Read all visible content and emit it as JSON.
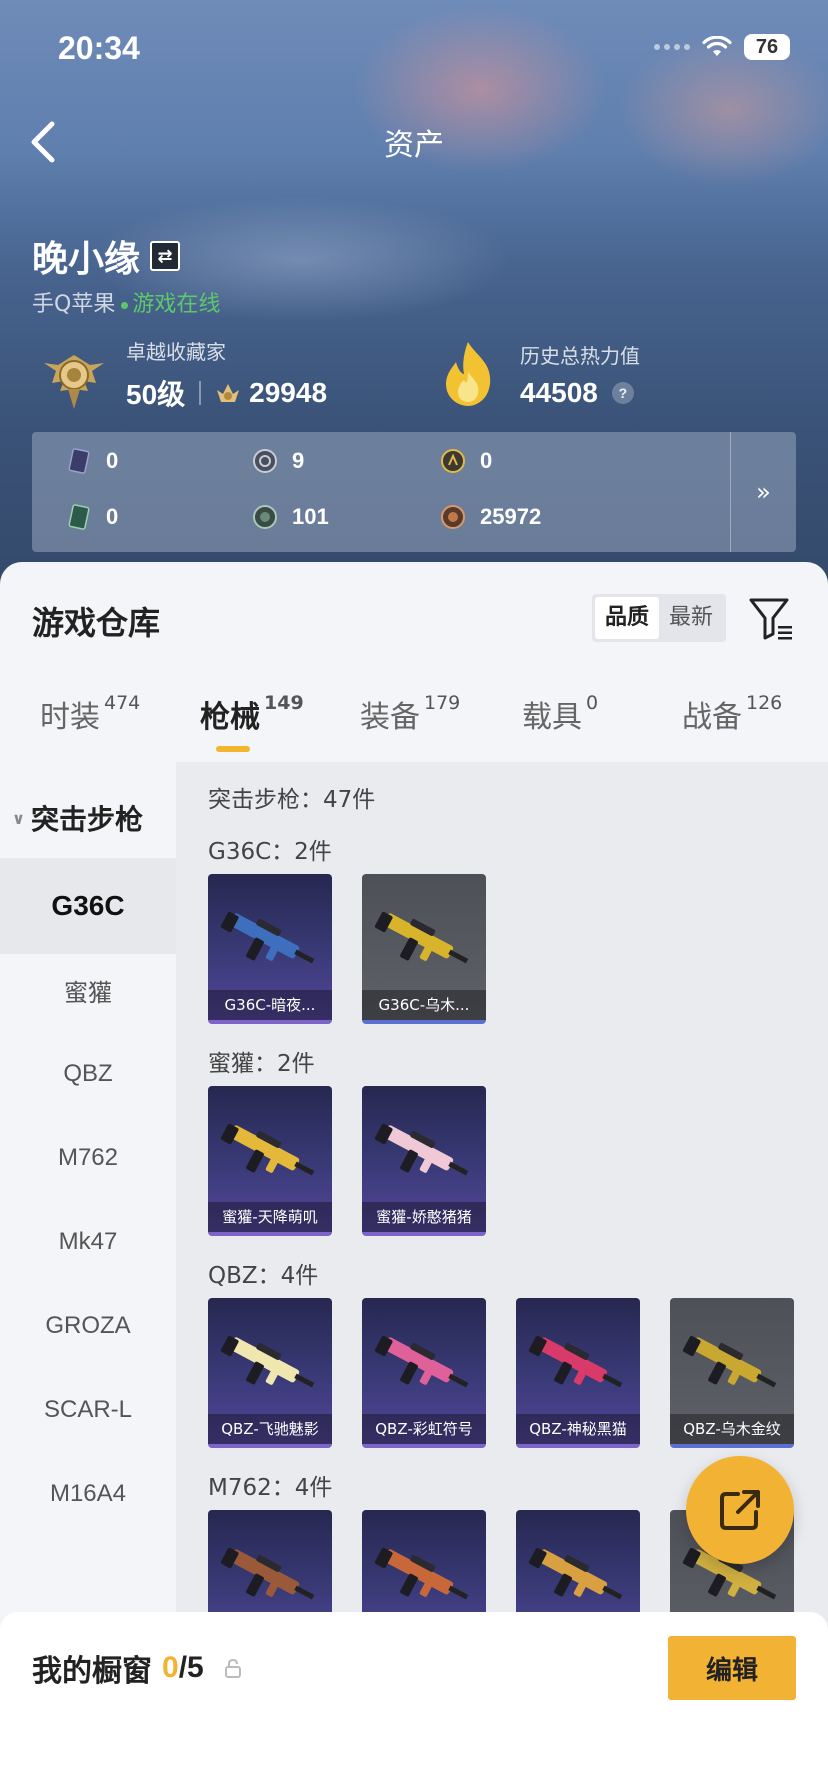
{
  "status_bar": {
    "time": "20:34",
    "battery": "76"
  },
  "nav": {
    "title": "资产"
  },
  "user": {
    "name": "晚小缘",
    "platform": "手Q苹果",
    "online_status": "游戏在线"
  },
  "collector": {
    "title": "卓越收藏家",
    "level": "50级",
    "points": "29948"
  },
  "heat": {
    "title": "历史总热力值",
    "value": "44508",
    "help": "?"
  },
  "currencies": {
    "row1": [
      "0",
      "9",
      "0"
    ],
    "row2": [
      "0",
      "101",
      "25972"
    ],
    "more": "»"
  },
  "warehouse": {
    "title": "游戏仓库",
    "sort": [
      "品质",
      "最新"
    ],
    "tabs": [
      {
        "label": "时装",
        "count": "474"
      },
      {
        "label": "枪械",
        "count": "149"
      },
      {
        "label": "装备",
        "count": "179"
      },
      {
        "label": "载具",
        "count": "0"
      },
      {
        "label": "战备",
        "count": "126"
      }
    ]
  },
  "sidebar": {
    "category": "突击步枪",
    "items": [
      "G36C",
      "蜜獾",
      "QBZ",
      "M762",
      "Mk47",
      "GROZA",
      "SCAR-L",
      "M16A4"
    ]
  },
  "content": {
    "summary": "突击步枪：47件",
    "groups": [
      {
        "title": "G36C：2件",
        "cards": [
          {
            "label": "G36C-暗夜...",
            "bg": "purple",
            "gun_color": "#3e6fbf"
          },
          {
            "label": "G36C-乌木...",
            "bg": "grey",
            "gun_color": "#d7b42c"
          }
        ]
      },
      {
        "title": "蜜獾：2件",
        "cards": [
          {
            "label": "蜜獾-天降萌叽",
            "bg": "purple",
            "gun_color": "#e4b83a"
          },
          {
            "label": "蜜獾-娇憨猪猪",
            "bg": "purple",
            "gun_color": "#f0c8d6"
          }
        ]
      },
      {
        "title": "QBZ：4件",
        "cards": [
          {
            "label": "QBZ-飞驰魅影",
            "bg": "purple",
            "gun_color": "#f0e6b0"
          },
          {
            "label": "QBZ-彩虹符号",
            "bg": "purple",
            "gun_color": "#e0609a"
          },
          {
            "label": "QBZ-神秘黑猫",
            "bg": "purple",
            "gun_color": "#d83a6a"
          },
          {
            "label": "QBZ-乌木金纹",
            "bg": "grey",
            "gun_color": "#c8a830"
          }
        ]
      },
      {
        "title": "M762：4件",
        "cards": [
          {
            "label": "",
            "bg": "purple",
            "gun_color": "#9a5a3a"
          },
          {
            "label": "",
            "bg": "purple",
            "gun_color": "#c8683a"
          },
          {
            "label": "",
            "bg": "purple",
            "gun_color": "#d8a040"
          },
          {
            "label": "",
            "bg": "grey",
            "gun_color": "#d0b040"
          }
        ]
      }
    ]
  },
  "showcase": {
    "title": "我的橱窗",
    "current": "0",
    "total": "/5",
    "edit_label": "编辑"
  },
  "colors": {
    "accent": "#f2b233",
    "online": "#5cc86a"
  }
}
